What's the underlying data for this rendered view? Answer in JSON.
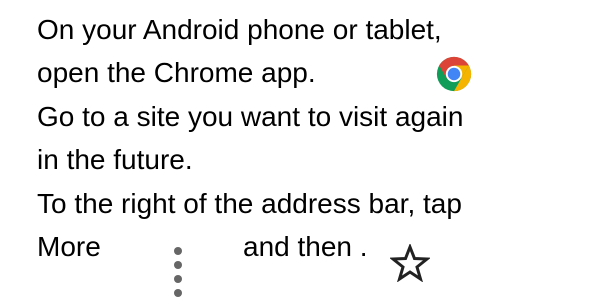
{
  "lines": [
    "On your Android phone or tablet,",
    "open the Chrome app.",
    "Go to a site you want to visit again",
    "in the future.",
    "To the right of the address bar, tap",
    "More"
  ],
  "and_then": "and then .",
  "icons": {
    "chrome": "chrome-logo-icon",
    "more": "more-vertical-dots-icon",
    "star": "star-outline-icon"
  },
  "colors": {
    "text": "#000000",
    "chrome_red": "#DB4437",
    "chrome_yellow": "#F4B400",
    "chrome_green": "#0F9D58",
    "chrome_blue": "#4285F4",
    "icon_gray": "#666666"
  }
}
